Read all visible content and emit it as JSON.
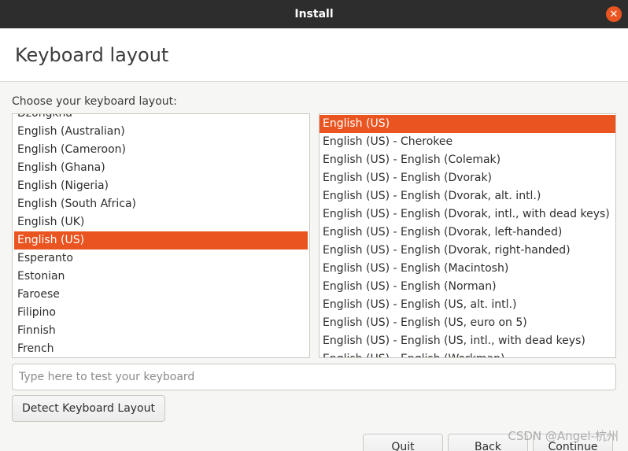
{
  "window": {
    "title": "Install",
    "close_glyph": "✕"
  },
  "header": {
    "title": "Keyboard layout"
  },
  "prompt": "Choose your keyboard layout:",
  "layouts": [
    {
      "label": "Dzongkha",
      "selected": false
    },
    {
      "label": "English (Australian)",
      "selected": false
    },
    {
      "label": "English (Cameroon)",
      "selected": false
    },
    {
      "label": "English (Ghana)",
      "selected": false
    },
    {
      "label": "English (Nigeria)",
      "selected": false
    },
    {
      "label": "English (South Africa)",
      "selected": false
    },
    {
      "label": "English (UK)",
      "selected": false
    },
    {
      "label": "English (US)",
      "selected": true
    },
    {
      "label": "Esperanto",
      "selected": false
    },
    {
      "label": "Estonian",
      "selected": false
    },
    {
      "label": "Faroese",
      "selected": false
    },
    {
      "label": "Filipino",
      "selected": false
    },
    {
      "label": "Finnish",
      "selected": false
    },
    {
      "label": "French",
      "selected": false
    }
  ],
  "variants": [
    {
      "label": "English (US)",
      "selected": true
    },
    {
      "label": "English (US) - Cherokee",
      "selected": false
    },
    {
      "label": "English (US) - English (Colemak)",
      "selected": false
    },
    {
      "label": "English (US) - English (Dvorak)",
      "selected": false
    },
    {
      "label": "English (US) - English (Dvorak, alt. intl.)",
      "selected": false
    },
    {
      "label": "English (US) - English (Dvorak, intl., with dead keys)",
      "selected": false
    },
    {
      "label": "English (US) - English (Dvorak, left-handed)",
      "selected": false
    },
    {
      "label": "English (US) - English (Dvorak, right-handed)",
      "selected": false
    },
    {
      "label": "English (US) - English (Macintosh)",
      "selected": false
    },
    {
      "label": "English (US) - English (Norman)",
      "selected": false
    },
    {
      "label": "English (US) - English (US, alt. intl.)",
      "selected": false
    },
    {
      "label": "English (US) - English (US, euro on 5)",
      "selected": false
    },
    {
      "label": "English (US) - English (US, intl., with dead keys)",
      "selected": false
    },
    {
      "label": "English (US) - English (Workman)",
      "selected": false
    }
  ],
  "test_input": {
    "value": "",
    "placeholder": "Type here to test your keyboard"
  },
  "buttons": {
    "detect": "Detect Keyboard Layout",
    "quit": "Quit",
    "back": "Back",
    "continue": "Continue"
  },
  "watermark": "CSDN @Angel-杭州",
  "colors": {
    "accent": "#e95420",
    "titlebar": "#2d2d2d"
  }
}
